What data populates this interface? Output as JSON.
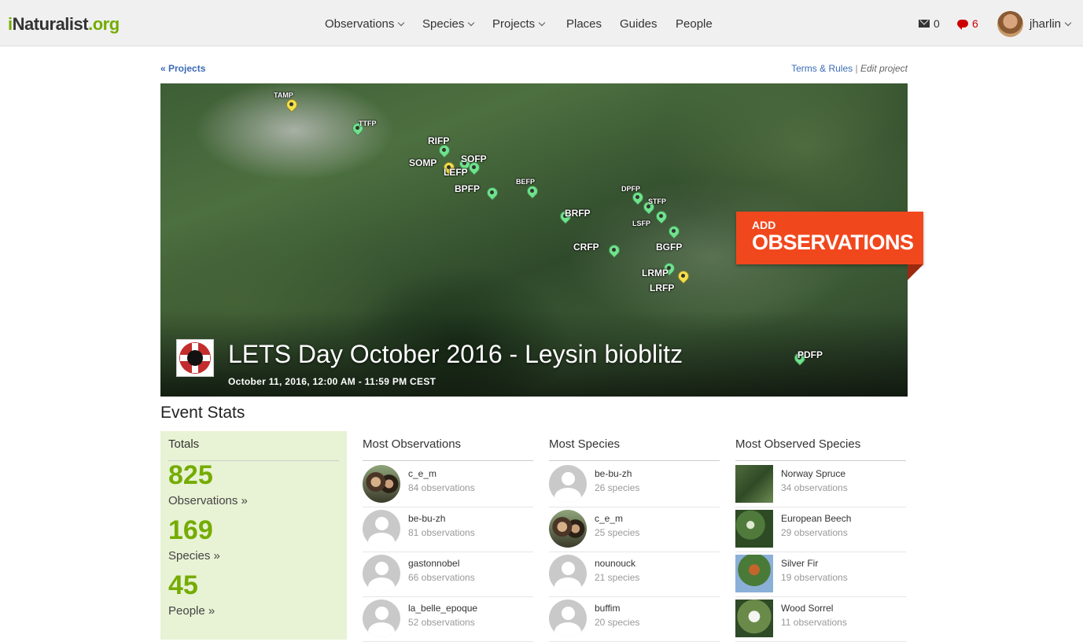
{
  "header": {
    "logo_i": "i",
    "logo_main": "Naturalist",
    "logo_org": ".org",
    "nav": [
      {
        "label": "Observations",
        "dropdown": true
      },
      {
        "label": "Species",
        "dropdown": true
      },
      {
        "label": "Projects",
        "dropdown": true
      },
      {
        "label": "Places",
        "dropdown": false
      },
      {
        "label": "Guides",
        "dropdown": false
      },
      {
        "label": "People",
        "dropdown": false
      }
    ],
    "mail_count": "0",
    "messages_count": "6",
    "username": "jharlin"
  },
  "links": {
    "back": "« Projects",
    "terms": "Terms & Rules",
    "separator": "|",
    "edit": "Edit project"
  },
  "banner": {
    "title": "LETS Day October 2016 - Leysin bioblitz",
    "date": "October 11, 2016, 12:00 AM - 11:59 PM CEST",
    "add_line1": "ADD",
    "add_line2": "OBSERVATIONS",
    "markers": [
      {
        "label": "TAMP",
        "color": "yellow"
      },
      {
        "label": "TTFP",
        "color": "green"
      },
      {
        "label": "RIFP",
        "color": "green"
      },
      {
        "label": "SOMP",
        "color": "yellow"
      },
      {
        "label": "SOFP",
        "color": "green"
      },
      {
        "label": "LEFP",
        "color": "green"
      },
      {
        "label": "BPFP",
        "color": "green"
      },
      {
        "label": "BEFP",
        "color": "green"
      },
      {
        "label": "BRFP",
        "color": "green"
      },
      {
        "label": "DPFP",
        "color": "green"
      },
      {
        "label": "STFP",
        "color": "green"
      },
      {
        "label": "LSFP",
        "color": "green"
      },
      {
        "label": "BGFP",
        "color": "green"
      },
      {
        "label": "CRFP",
        "color": "green"
      },
      {
        "label": "LRMP",
        "color": "green"
      },
      {
        "label": "LRFP",
        "color": "yellow"
      },
      {
        "label": "PDFP",
        "color": "green"
      }
    ]
  },
  "stats": {
    "title": "Event Stats",
    "totals": {
      "heading": "Totals",
      "observations": {
        "count": "825",
        "label": "Observations »"
      },
      "species": {
        "count": "169",
        "label": "Species »"
      },
      "people": {
        "count": "45",
        "label": "People »"
      }
    },
    "most_observations": {
      "heading": "Most Observations",
      "rows": [
        {
          "name": "c_e_m",
          "sub": "84 observations",
          "avatar": "photo"
        },
        {
          "name": "be-bu-zh",
          "sub": "81 observations",
          "avatar": "default"
        },
        {
          "name": "gastonnobel",
          "sub": "66 observations",
          "avatar": "default"
        },
        {
          "name": "la_belle_epoque",
          "sub": "52 observations",
          "avatar": "default"
        }
      ]
    },
    "most_species": {
      "heading": "Most Species",
      "rows": [
        {
          "name": "be-bu-zh",
          "sub": "26 species",
          "avatar": "default"
        },
        {
          "name": "c_e_m",
          "sub": "25 species",
          "avatar": "photo"
        },
        {
          "name": "nounouck",
          "sub": "21 species",
          "avatar": "default"
        },
        {
          "name": "buffim",
          "sub": "20 species",
          "avatar": "default"
        }
      ]
    },
    "most_observed_species": {
      "heading": "Most Observed Species",
      "rows": [
        {
          "name": "Norway Spruce",
          "sub": "34 observations"
        },
        {
          "name": "European Beech",
          "sub": "29 observations"
        },
        {
          "name": "Silver Fir",
          "sub": "19 observations"
        },
        {
          "name": "Wood Sorrel",
          "sub": "11 observations"
        }
      ]
    }
  },
  "colors": {
    "brand_green": "#74ac00",
    "link_blue": "#3a6bb5",
    "add_orange": "#f1471d",
    "totals_bg": "#e8f2d5",
    "alert_red": "#cc0000"
  }
}
